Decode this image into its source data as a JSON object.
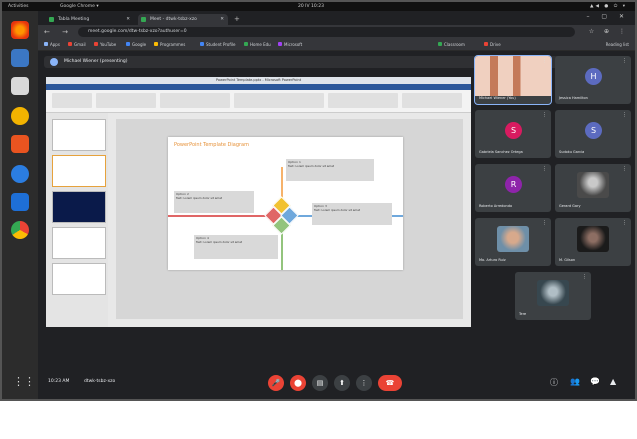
{
  "topbar": {
    "activities": "Activities",
    "app": "Google Chrome ▾",
    "clock": "20 IV 10:23",
    "tray": "▲◀ ● ⏻ ▾"
  },
  "browser": {
    "tabs": [
      {
        "label": "Tabla Meeting"
      },
      {
        "label": "Meet - dtwk-tsbz-xzo"
      }
    ],
    "url": "meet.google.com/dtw-tsbz-xzo?authuser=0",
    "nav_icons": "← → ⟳",
    "ext_icons": "☆ ⊕ ⋮",
    "window_icons": "– ▢ ✕",
    "new_tab": "+",
    "bookmarks": [
      {
        "label": "Apps",
        "color": "#8ab4f8"
      },
      {
        "label": "Gmail",
        "color": "#ea4335"
      },
      {
        "label": "YouTube",
        "color": "#ea4335"
      },
      {
        "label": "Google",
        "color": "#4285f4"
      },
      {
        "label": "Programmes",
        "color": "#fbbc04"
      },
      {
        "label": "Student Profile",
        "color": "#4285f4"
      },
      {
        "label": "Home Edu",
        "color": "#34a853"
      },
      {
        "label": "Microsoft",
        "color": "#a142f4"
      },
      {
        "label": "Classroom",
        "color": "#34a853"
      },
      {
        "label": "Drive",
        "color": "#ea4335"
      }
    ],
    "reading_list": "Reading list"
  },
  "meet": {
    "presenting": "Michael Wiener (presenting)",
    "participants": [
      {
        "name": "Michael Wiener (You)",
        "initial": "",
        "color": "#c47a5a",
        "video": true,
        "active": true
      },
      {
        "name": "Jessica Hamilton",
        "initial": "H",
        "color": "#5c6bc0",
        "video": false
      },
      {
        "name": "Gabriela Sanchez Ortega",
        "initial": "S",
        "color": "#d81b60",
        "video": false
      },
      {
        "name": "Sudoku Garcia",
        "initial": "S",
        "color": "#5c6bc0",
        "video": false
      },
      {
        "name": "Roberto Arredondo",
        "initial": "R",
        "color": "#8e24aa",
        "video": false
      },
      {
        "name": "Gerard Gary",
        "initial": "",
        "color": "#6d6d6d",
        "video": true
      },
      {
        "name": "Mo. Arturo Ruiz",
        "initial": "",
        "color": "#8d6e63",
        "video": true
      },
      {
        "name": "M. Gilson",
        "initial": "",
        "color": "#5d4037",
        "video": true
      },
      {
        "name": "Tere",
        "initial": "",
        "color": "#78909c",
        "video": true
      }
    ],
    "bottom": {
      "time": "10:23 AM",
      "code": "dtwk-tsbz-xzo"
    },
    "controls": {
      "mic": "🎤",
      "cam": "⬤",
      "cc": "▤",
      "present": "⬆",
      "more": "⋮",
      "hangup": "☎"
    },
    "right_controls": {
      "info": "ⓘ",
      "people": "👥",
      "chat": "💬",
      "activities": "▲"
    }
  },
  "slide": {
    "title": "PowerPoint Template Diagram",
    "ppt_title": "PowerPoint Template.pptx - Microsoft PowerPoint",
    "labels": [
      "Option 1",
      "Option 2",
      "Option 3",
      "Option 4"
    ],
    "box_text": "Text: Lorem ipsum dolor sit amet"
  },
  "colors": {
    "accent": "#8ab4f8",
    "hangup": "#ea4335"
  }
}
